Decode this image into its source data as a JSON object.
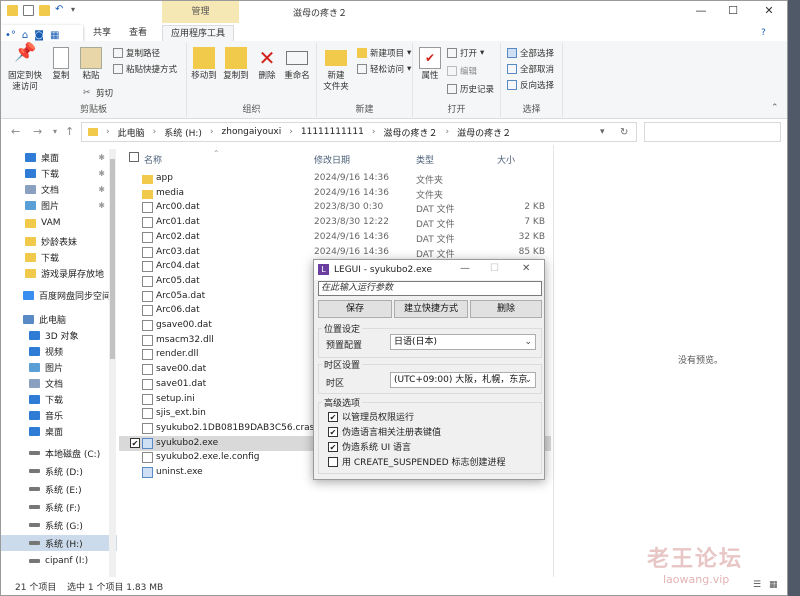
{
  "window": {
    "title": "滋母の疼き２",
    "min": "—",
    "max": "☐",
    "close": "✕",
    "context_tab": "管理"
  },
  "tabs": [
    "文件",
    "主页",
    "共享",
    "查看",
    "应用程序工具"
  ],
  "ribbon": {
    "clipboard": {
      "label": "剪贴板",
      "pin": "固定到快\n速访问",
      "copy": "复制",
      "paste": "粘贴",
      "copy_path": "复制路径",
      "paste_shortcut": "粘贴快捷方式",
      "cut": "剪切"
    },
    "organize": {
      "label": "组织",
      "move_to": "移动到",
      "copy_to": "复制到",
      "delete": "删除",
      "rename": "重命名"
    },
    "new": {
      "label": "新建",
      "new_folder": "新建\n文件夹",
      "new_item": "新建项目",
      "easy_access": "轻松访问"
    },
    "open": {
      "label": "打开",
      "properties": "属性",
      "open": "打开",
      "edit": "编辑",
      "history": "历史记录"
    },
    "select": {
      "label": "选择",
      "all": "全部选择",
      "none": "全部取消",
      "invert": "反向选择"
    }
  },
  "address": {
    "path": [
      "此电脑",
      "系统 (H:)",
      "zhongaiyouxi",
      "11111111111",
      "滋母の疼き２",
      "滋母の疼き２"
    ]
  },
  "nav": [
    {
      "label": "桌面",
      "type": "blue",
      "pin": true
    },
    {
      "label": "下载",
      "type": "down",
      "pin": true
    },
    {
      "label": "文档",
      "type": "doc",
      "pin": true
    },
    {
      "label": "图片",
      "type": "pic",
      "pin": true
    },
    {
      "label": "VAM",
      "type": "folder"
    },
    {
      "label": "妙龄表妹",
      "type": "folder"
    },
    {
      "label": "下载",
      "type": "folder"
    },
    {
      "label": "游戏录屏存放地",
      "type": "folder"
    },
    {
      "label": "百度网盘同步空间",
      "type": "cloud"
    },
    {
      "label": "此电脑",
      "type": "pc"
    },
    {
      "label": "3D 对象",
      "type": "blue"
    },
    {
      "label": "视频",
      "type": "blue"
    },
    {
      "label": "图片",
      "type": "pic"
    },
    {
      "label": "文档",
      "type": "doc"
    },
    {
      "label": "下载",
      "type": "down"
    },
    {
      "label": "音乐",
      "type": "music"
    },
    {
      "label": "桌面",
      "type": "blue"
    },
    {
      "label": "本地磁盘 (C:)",
      "type": "drive"
    },
    {
      "label": "系统 (D:)",
      "type": "drive"
    },
    {
      "label": "系统 (E:)",
      "type": "drive"
    },
    {
      "label": "系统 (F:)",
      "type": "drive"
    },
    {
      "label": "系统 (G:)",
      "type": "drive"
    },
    {
      "label": "系统 (H:)",
      "type": "drive",
      "selected": true
    },
    {
      "label": "cipanf (I:)",
      "type": "drive"
    }
  ],
  "columns": {
    "name": "名称",
    "date": "修改日期",
    "type": "类型",
    "size": "大小"
  },
  "files": [
    {
      "name": "app",
      "date": "2024/9/16 14:36",
      "type": "文件夹",
      "size": "",
      "icon": "folder"
    },
    {
      "name": "media",
      "date": "2024/9/16 14:36",
      "type": "文件夹",
      "size": "",
      "icon": "folder"
    },
    {
      "name": "Arc00.dat",
      "date": "2023/8/30 0:30",
      "type": "DAT 文件",
      "size": "2 KB",
      "icon": "doc"
    },
    {
      "name": "Arc01.dat",
      "date": "2023/8/30 12:22",
      "type": "DAT 文件",
      "size": "7 KB",
      "icon": "doc"
    },
    {
      "name": "Arc02.dat",
      "date": "2024/9/16 14:36",
      "type": "DAT 文件",
      "size": "32 KB",
      "icon": "doc"
    },
    {
      "name": "Arc03.dat",
      "date": "2024/9/16 14:36",
      "type": "DAT 文件",
      "size": "85 KB",
      "icon": "doc"
    },
    {
      "name": "Arc04.dat",
      "date": "",
      "type": "",
      "size": "",
      "icon": "doc"
    },
    {
      "name": "Arc05.dat",
      "date": "",
      "type": "",
      "size": "",
      "icon": "doc"
    },
    {
      "name": "Arc05a.dat",
      "date": "",
      "type": "",
      "size": "",
      "icon": "doc"
    },
    {
      "name": "Arc06.dat",
      "date": "",
      "type": "",
      "size": "",
      "icon": "doc"
    },
    {
      "name": "gsave00.dat",
      "date": "",
      "type": "",
      "size": "",
      "icon": "doc"
    },
    {
      "name": "msacm32.dll",
      "date": "",
      "type": "",
      "size": "",
      "icon": "doc"
    },
    {
      "name": "render.dll",
      "date": "",
      "type": "",
      "size": "",
      "icon": "doc"
    },
    {
      "name": "save00.dat",
      "date": "",
      "type": "",
      "size": "",
      "icon": "doc"
    },
    {
      "name": "save01.dat",
      "date": "",
      "type": "",
      "size": "",
      "icon": "doc"
    },
    {
      "name": "setup.ini",
      "date": "",
      "type": "",
      "size": "",
      "icon": "doc"
    },
    {
      "name": "sjis_ext.bin",
      "date": "",
      "type": "",
      "size": "",
      "icon": "doc"
    },
    {
      "name": "syukubo2.1DB081B9DAB3C56.cras...",
      "date": "",
      "type": "",
      "size": "",
      "icon": "doc"
    },
    {
      "name": "syukubo2.exe",
      "date": "",
      "type": "",
      "size": "",
      "icon": "exe",
      "selected": true
    },
    {
      "name": "syukubo2.exe.le.config",
      "date": "",
      "type": "",
      "size": "",
      "icon": "doc"
    },
    {
      "name": "uninst.exe",
      "date": "",
      "type": "",
      "size": "",
      "icon": "exe"
    }
  ],
  "preview": {
    "text": "没有预览。"
  },
  "status": {
    "count": "21 个项目",
    "selected": "选中 1 个项目  1.83 MB"
  },
  "dialog": {
    "title": "LEGUI - syukubo2.exe",
    "placeholder": "在此输入运行参数",
    "btn_save": "保存",
    "btn_shortcut": "建立快捷方式",
    "btn_delete": "删除",
    "loc_group": "位置设定",
    "loc_label": "预置配置",
    "loc_value": "日语(日本)",
    "tz_group": "时区设置",
    "tz_label": "时区",
    "tz_value": "(UTC+09:00) 大阪，札幌，东京",
    "adv_group": "高级选项",
    "options": [
      {
        "label": "以管理员权限运行",
        "checked": true
      },
      {
        "label": "伪造语言相关注册表键值",
        "checked": true
      },
      {
        "label": "伪造系统 UI 语言",
        "checked": true
      },
      {
        "label": "用 CREATE_SUSPENDED 标志创建进程",
        "checked": false
      }
    ]
  },
  "watermark": {
    "main": "老王论坛",
    "sub": "laowang.vip"
  },
  "colors": {
    "accent": "#1a5fb4",
    "selection": "#ccdbeb",
    "folder": "#f1c94b",
    "context": "#f6e8b4"
  }
}
